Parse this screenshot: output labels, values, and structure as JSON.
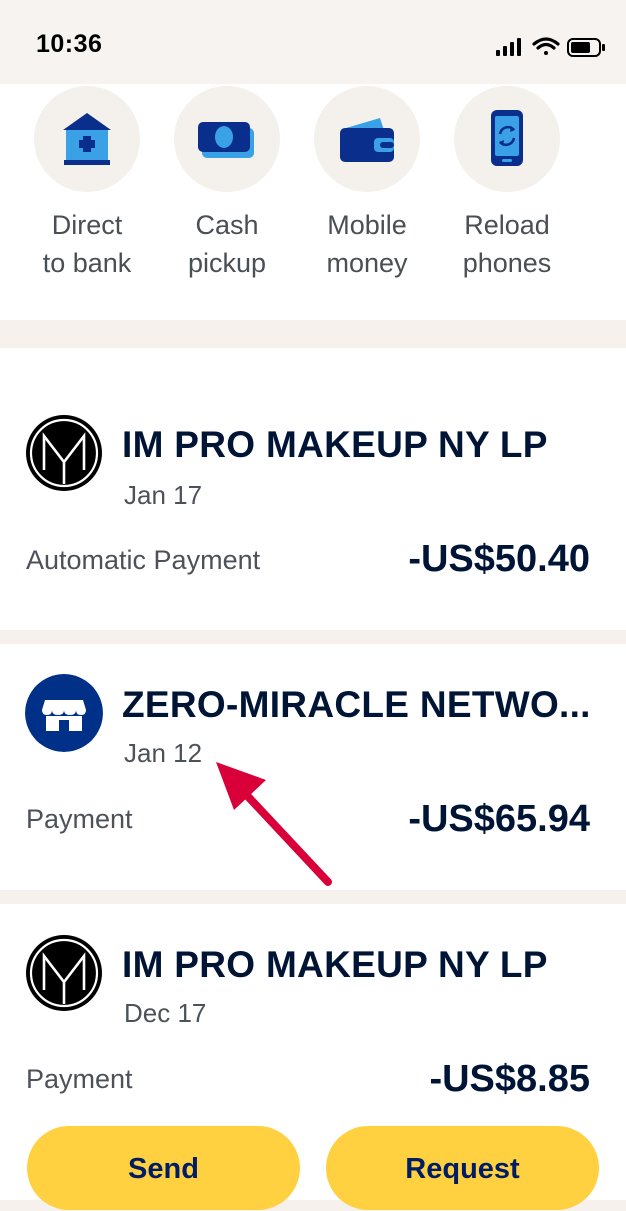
{
  "status_bar": {
    "time": "10:36"
  },
  "quick_actions": [
    {
      "label": "Direct\nto bank",
      "icon": "bank-icon"
    },
    {
      "label": "Cash\npickup",
      "icon": "cash-icon"
    },
    {
      "label": "Mobile\nmoney",
      "icon": "wallet-icon"
    },
    {
      "label": "Reload\nphones",
      "icon": "phone-reload-icon"
    }
  ],
  "transactions": [
    {
      "merchant": "IM PRO MAKEUP NY LP",
      "date": "Jan 17",
      "type": "Automatic Payment",
      "amount": "-US$50.40",
      "logo": "im-pro-logo"
    },
    {
      "merchant": "ZERO-MIRACLE NETWO...",
      "date": "Jan 12",
      "type": "Payment",
      "amount": "-US$65.94",
      "logo": "store-icon"
    },
    {
      "merchant": "IM PRO MAKEUP NY LP",
      "date": "Dec 17",
      "type": "Payment",
      "amount": "-US$8.85",
      "logo": "im-pro-logo"
    }
  ],
  "actions": {
    "send_label": "Send",
    "request_label": "Request"
  },
  "colors": {
    "brand_navy": "#001435",
    "accent_blue": "#003087",
    "button_yellow": "#ffd140",
    "annotation_red": "#d9003a"
  }
}
